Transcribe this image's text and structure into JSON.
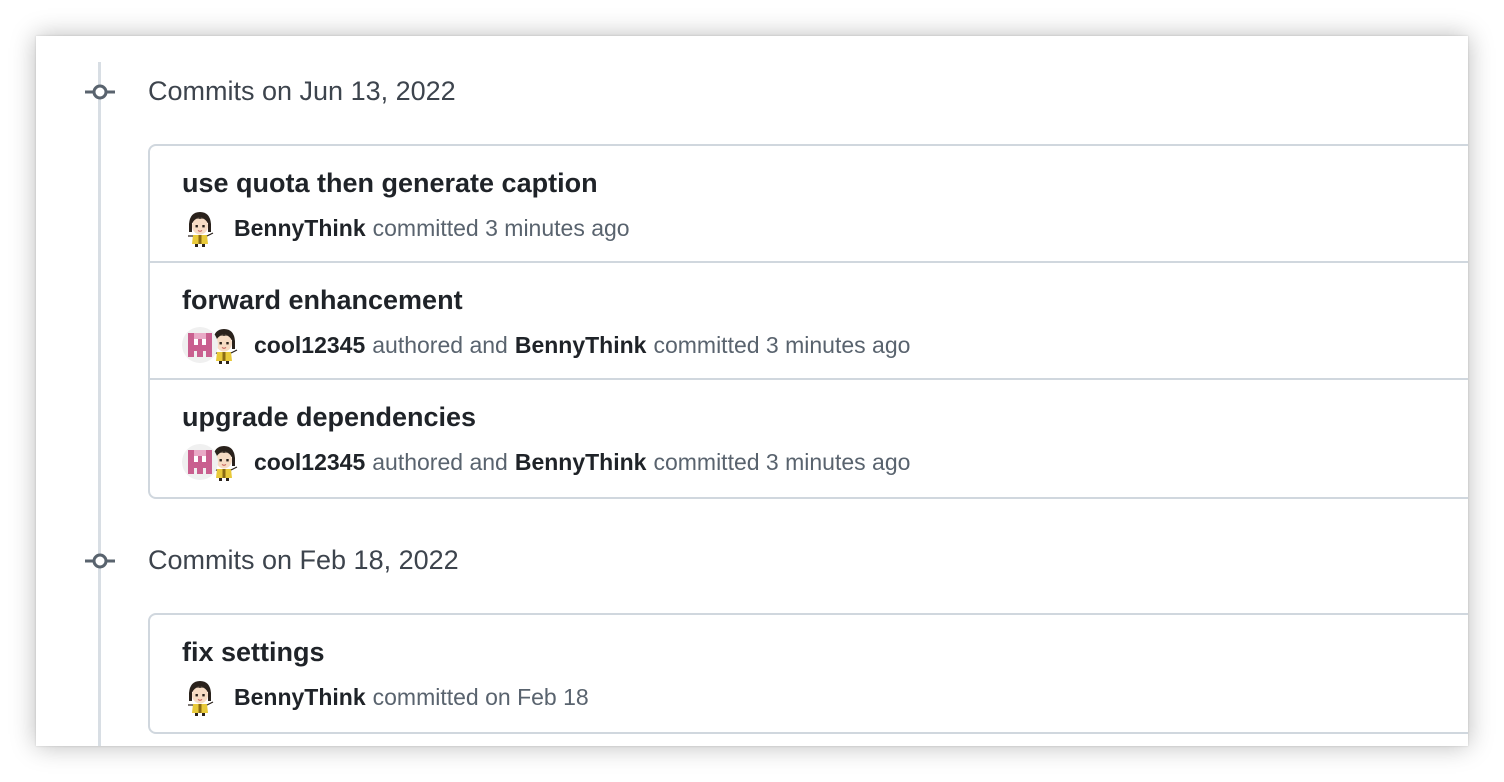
{
  "groups": [
    {
      "header": "Commits on Jun 13, 2022",
      "commits": [
        {
          "title": "use quota then generate caption",
          "committer": "BennyThink",
          "committed_text": "committed 3 minutes ago"
        },
        {
          "title": "forward enhancement",
          "author": "cool12345",
          "authored_text": "authored and",
          "committer": "BennyThink",
          "committed_text": "committed 3 minutes ago"
        },
        {
          "title": "upgrade dependencies",
          "author": "cool12345",
          "authored_text": "authored and",
          "committer": "BennyThink",
          "committed_text": "committed 3 minutes ago"
        }
      ]
    },
    {
      "header": "Commits on Feb 18, 2022",
      "commits": [
        {
          "title": "fix settings",
          "committer": "BennyThink",
          "committed_text": "committed on Feb 18"
        }
      ]
    }
  ],
  "colors": {
    "timeline": "#d8dee4",
    "border": "#d0d7de",
    "title_text": "#1f2328",
    "meta_text": "#59636e",
    "identicon_pink": "#c95f8f"
  },
  "icons": {
    "group": "git-commit-icon",
    "committer_avatar": "anime-girl-avatar",
    "author_avatar": "pink-identicon-avatar"
  }
}
